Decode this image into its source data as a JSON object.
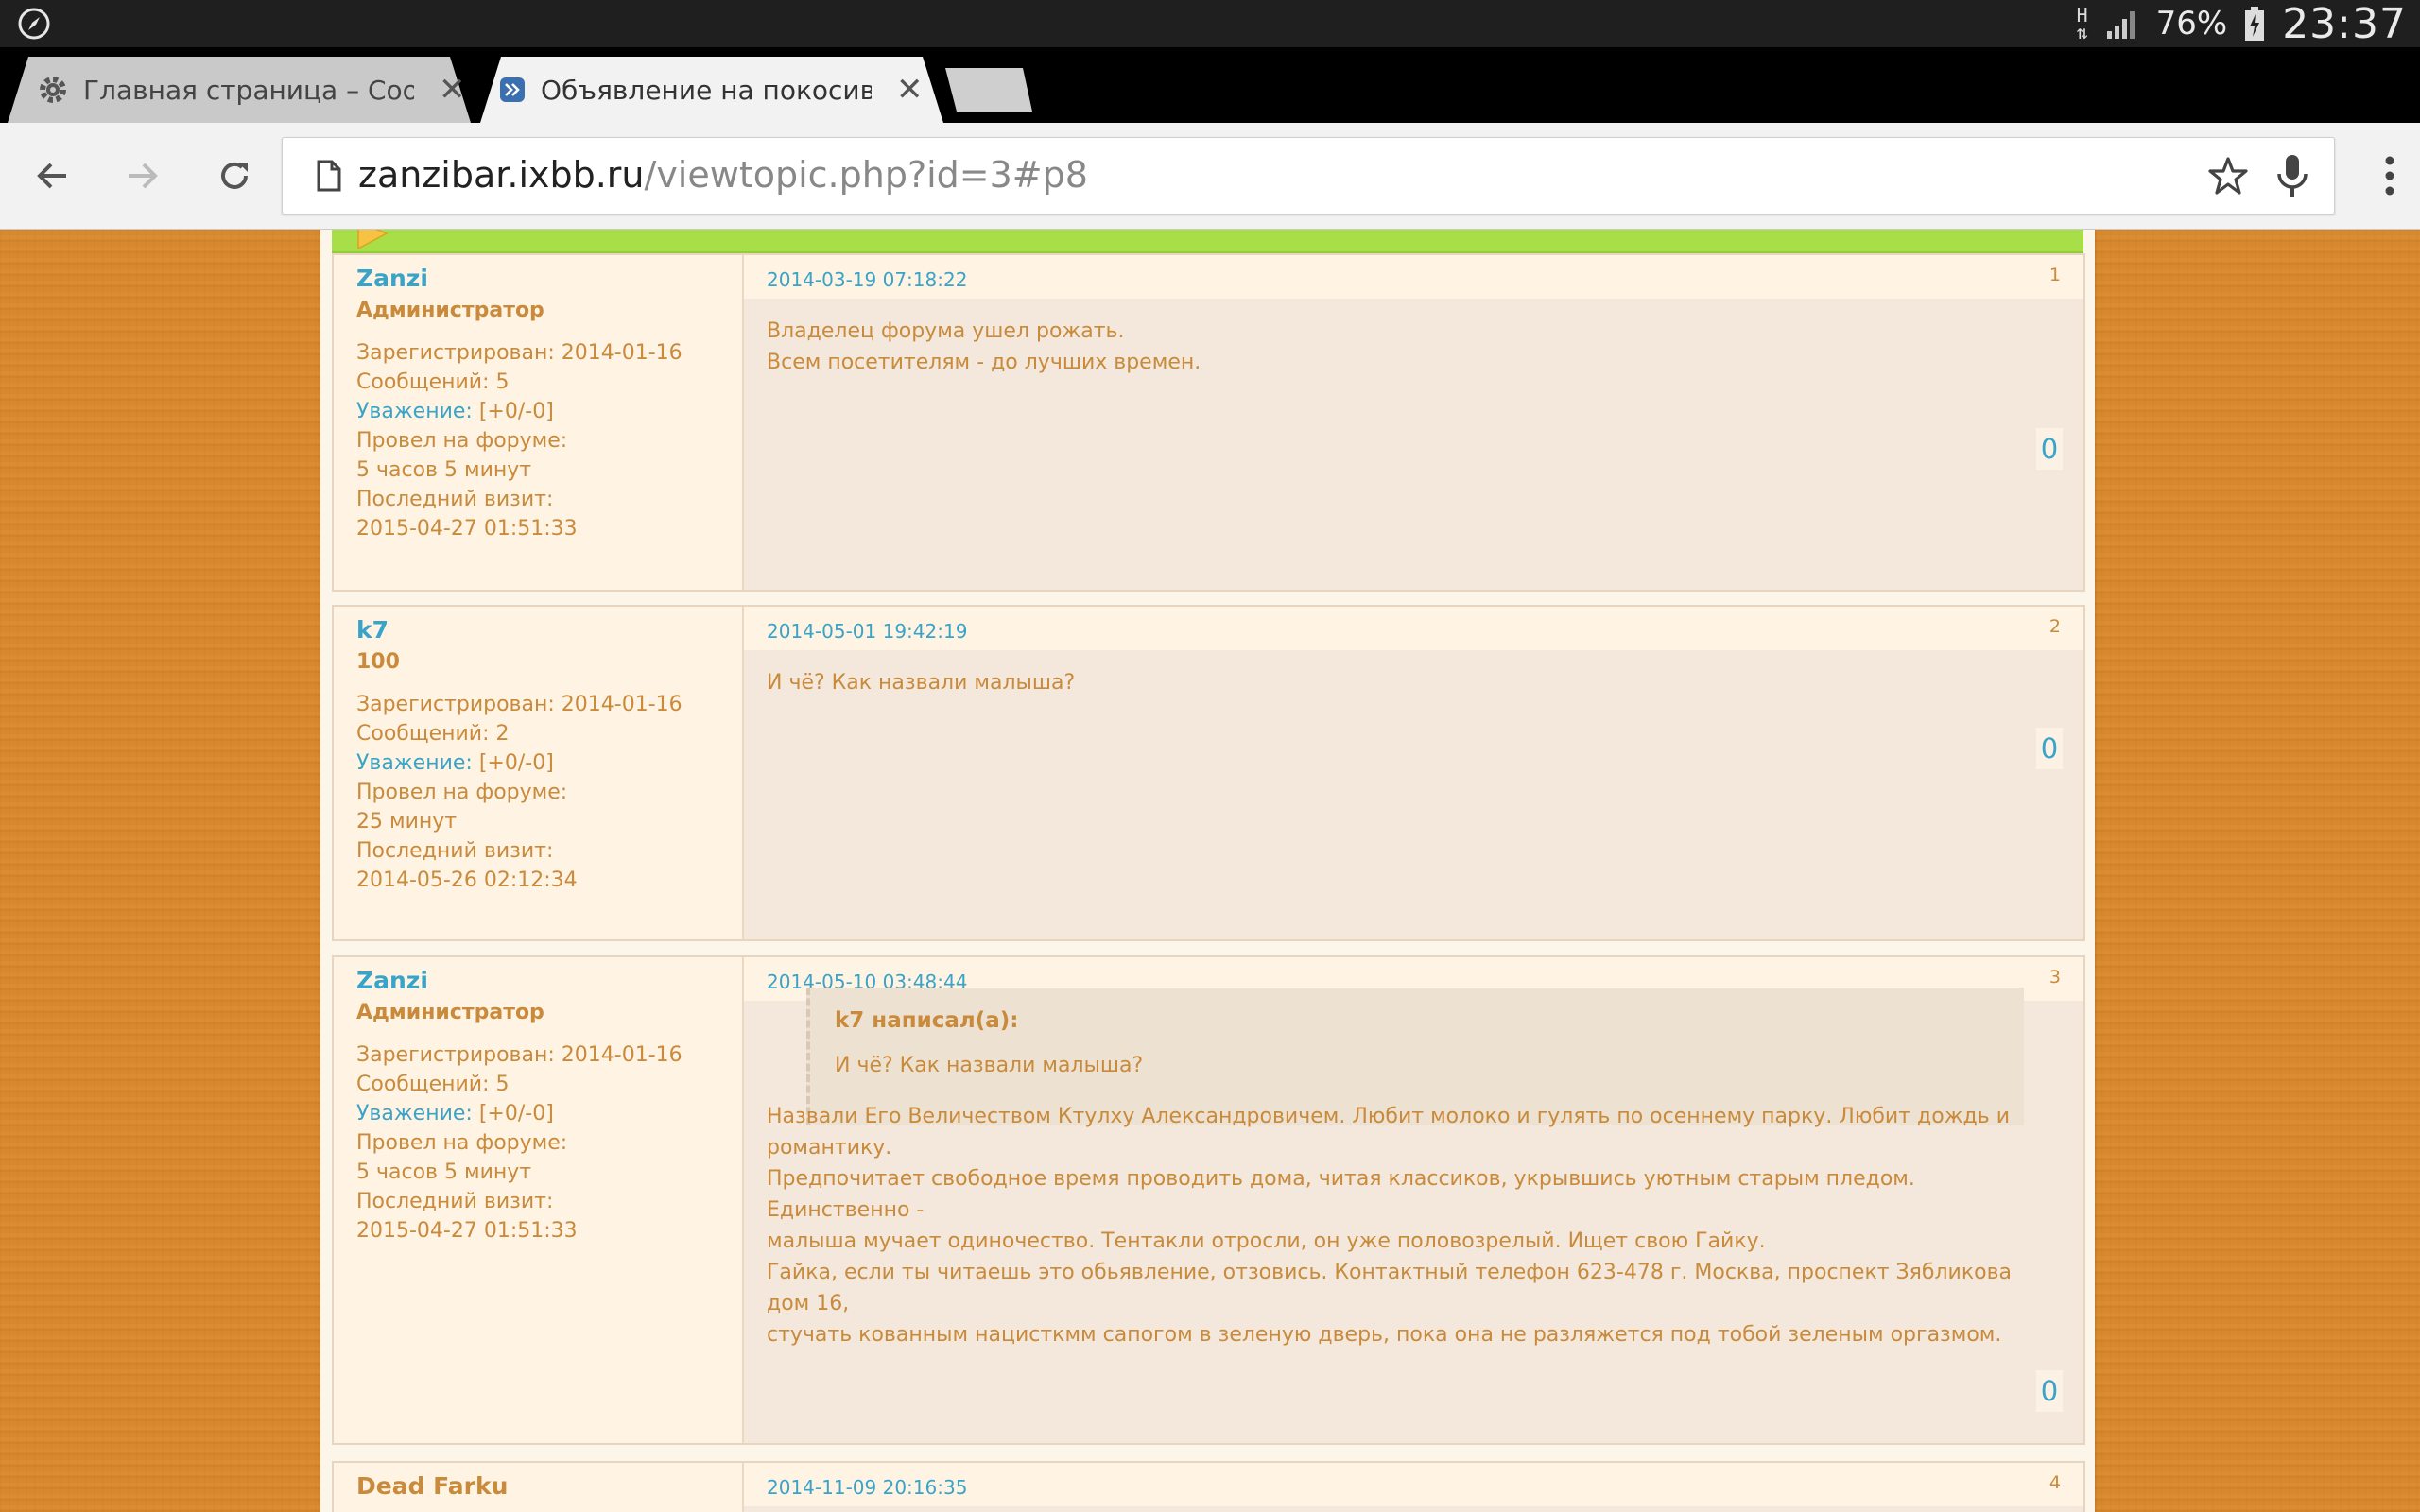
{
  "statusbar": {
    "network_label": "H",
    "battery_percent": "76%",
    "time": "23:37"
  },
  "tabs": [
    {
      "title": "Главная страница – Сообще",
      "icon": "gear-icon",
      "active": false
    },
    {
      "title": "Объявление на покосившем",
      "icon": "forward-icon",
      "active": true
    }
  ],
  "omnibox": {
    "host": "zanzibar.ixbb.ru",
    "path": "/viewtopic.php?id=3#p8"
  },
  "posts": [
    {
      "number": "1",
      "date": "2014-03-19 07:18:22",
      "author": "Zanzi",
      "role": "Администратор",
      "registered": "Зарегистрирован: 2014-01-16",
      "messages": "Сообщений: 5",
      "respect_label": "Уважение:",
      "respect_value": " [+0/-0]",
      "online_label": "Провел на форуме:",
      "online_value": "5 часов 5 минут",
      "last_visit_label": "Последний визит:",
      "last_visit_value": "2015-04-27 01:51:33",
      "text": [
        "Владелец форума ушел рожать.",
        "Всем посетителям - до лучших времен."
      ],
      "rating": "0"
    },
    {
      "number": "2",
      "date": "2014-05-01 19:42:19",
      "author": "k7",
      "role": "100",
      "registered": "Зарегистрирован: 2014-01-16",
      "messages": "Сообщений: 2",
      "respect_label": "Уважение:",
      "respect_value": " [+0/-0]",
      "online_label": "Провел на форуме:",
      "online_value": "25 минут",
      "last_visit_label": "Последний визит:",
      "last_visit_value": "2014-05-26 02:12:34",
      "text": [
        "И чё? Как назвали малыша?"
      ],
      "rating": "0"
    },
    {
      "number": "3",
      "date": "2014-05-10 03:48:44",
      "author": "Zanzi",
      "role": "Администратор",
      "registered": "Зарегистрирован: 2014-01-16",
      "messages": "Сообщений: 5",
      "respect_label": "Уважение:",
      "respect_value": " [+0/-0]",
      "online_label": "Провел на форуме:",
      "online_value": "5 часов 5 минут",
      "last_visit_label": "Последний визит:",
      "last_visit_value": "2015-04-27 01:51:33",
      "quote_head": "k7 написал(а):",
      "quote_text": "И чё? Как назвали малыша?",
      "text": [
        "Назвали Его Величеством Ктулху Александровичем. Любит молоко и гулять по осеннему парку. Любит дождь и романтику.",
        "Предпочитает свободное время проводить дома, читая классиков, укрывшись уютным старым пледом. Единственно -",
        "малыша мучает одиночество. Тентакли отросли, он уже половозрелый. Ищет свою Гайку.",
        "Гайка, если ты читаешь это обьявление, отзовись. Контактный телефон 623-478 г. Москва, проспект Зябликова дом 16,",
        "стучать кованным нацисткмм сапогом в зеленую дверь, пока она не разляжется под тобой зеленым оргазмом."
      ],
      "rating": "0"
    },
    {
      "number": "4",
      "date": "2014-11-09 20:16:35",
      "author": "Dead Farku"
    }
  ]
}
